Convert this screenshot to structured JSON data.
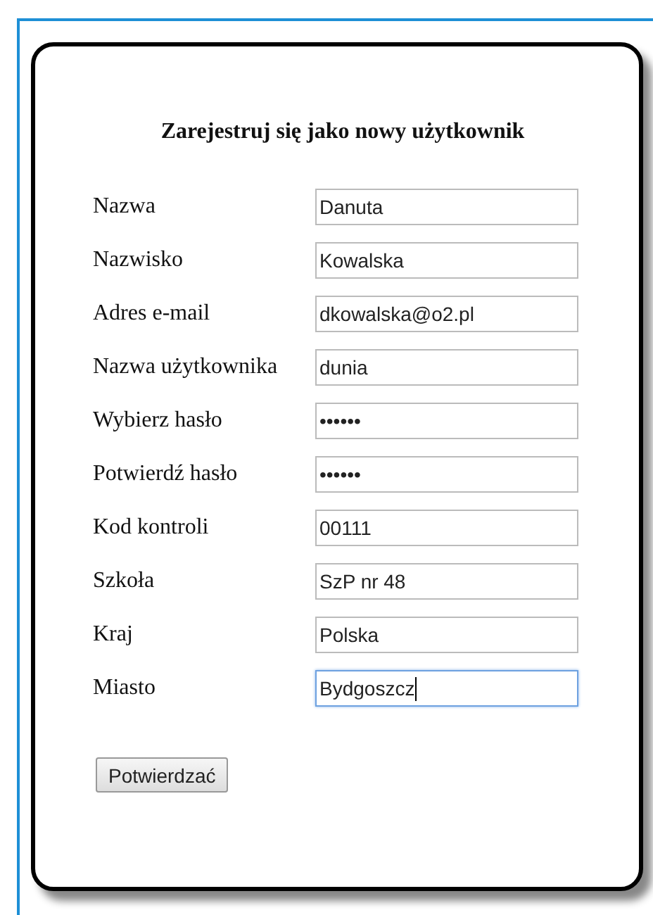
{
  "form": {
    "title": "Zarejestruj się jako nowy użytkownik",
    "fields": [
      {
        "label": "Nazwa",
        "value": "Danuta",
        "focused": false
      },
      {
        "label": "Nazwisko",
        "value": "Kowalska",
        "focused": false
      },
      {
        "label": "Adres e-mail",
        "value": "dkowalska@o2.pl",
        "focused": false
      },
      {
        "label": "Nazwa użytkownika",
        "value": "dunia",
        "focused": false
      },
      {
        "label": "Wybierz hasło",
        "value": "••••••",
        "focused": false
      },
      {
        "label": "Potwierdź hasło",
        "value": "••••••",
        "focused": false
      },
      {
        "label": "Kod kontroli",
        "value": "00111",
        "focused": false
      },
      {
        "label": "Szkoła",
        "value": "SzP nr 48",
        "focused": false
      },
      {
        "label": "Kraj",
        "value": "Polska",
        "focused": false
      },
      {
        "label": "Miasto",
        "value": "Bydgoszcz",
        "focused": true
      }
    ],
    "submit_button": "Potwierdzać"
  }
}
